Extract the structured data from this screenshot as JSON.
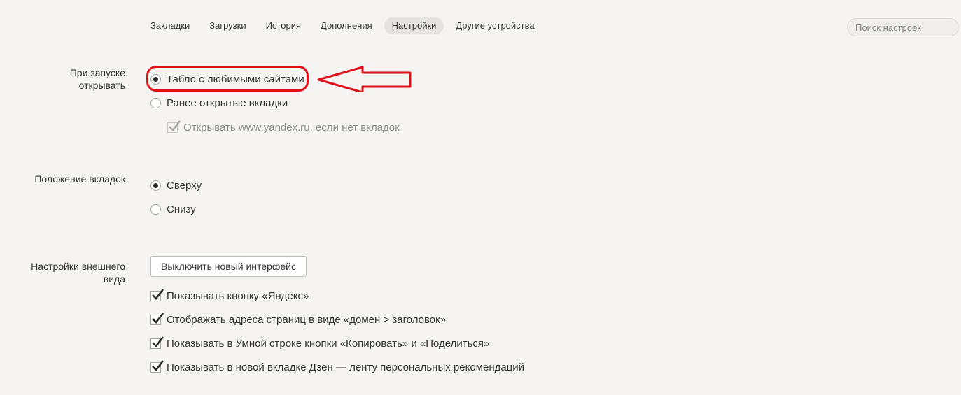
{
  "nav": {
    "items": [
      {
        "label": "Закладки",
        "active": false
      },
      {
        "label": "Загрузки",
        "active": false
      },
      {
        "label": "История",
        "active": false
      },
      {
        "label": "Дополнения",
        "active": false
      },
      {
        "label": "Настройки",
        "active": true
      },
      {
        "label": "Другие устройства",
        "active": false
      }
    ]
  },
  "search": {
    "placeholder": "Поиск настроек",
    "value": ""
  },
  "startup": {
    "label_line1": "При запуске",
    "label_line2": "открывать",
    "options": [
      {
        "label": "Табло с любимыми сайтами",
        "checked": true
      },
      {
        "label": "Ранее открытые вкладки",
        "checked": false
      }
    ],
    "sub_checkbox": {
      "label": "Открывать www.yandex.ru, если нет вкладок",
      "checked": true,
      "disabled": true
    }
  },
  "tabs_position": {
    "label": "Положение вкладок",
    "options": [
      {
        "label": "Сверху",
        "checked": true
      },
      {
        "label": "Снизу",
        "checked": false
      }
    ]
  },
  "appearance": {
    "label_line1": "Настройки внешнего",
    "label_line2": "вида",
    "button_label": "Выключить новый интерфейс",
    "checkboxes": [
      {
        "label": "Показывать кнопку «Яндекс»",
        "checked": true
      },
      {
        "label": "Отображать адреса страниц в виде «домен > заголовок»",
        "checked": true
      },
      {
        "label": "Показывать в Умной строке кнопки «Копировать» и «Поделиться»",
        "checked": true
      },
      {
        "label": "Показывать в новой вкладке Дзен — ленту персональных рекомендаций",
        "checked": true
      }
    ]
  },
  "annotation": {
    "color": "#e0101a",
    "shape": "arrow-left-icon"
  }
}
